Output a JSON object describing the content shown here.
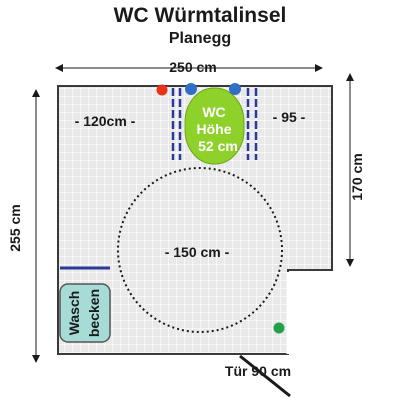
{
  "title": "WC Würmtalinsel",
  "subtitle": "Planegg",
  "dimensions": {
    "width_top": "250 cm",
    "height_left": "255 cm",
    "height_right": "170 cm",
    "left_clearance": "- 120cm -",
    "right_clearance": "- 95 -",
    "turning_circle": "- 150 cm -",
    "door": "Tür 90 cm"
  },
  "toilet": {
    "line1": "WC",
    "line2": "Höhe",
    "line3": "52 cm"
  },
  "sink": {
    "line1": "Wasch",
    "line2": "becken"
  },
  "colors": {
    "floor": "#e9e9e9",
    "tile_line": "#ffffff",
    "wall": "#3a3a3a",
    "toilet": "#8fd12b",
    "rail": "#2b3a9a",
    "sink": "#a7dcd6",
    "red_dot": "#e8331c",
    "blue_dot": "#2f6fc6",
    "green_dot": "#22a14a"
  }
}
